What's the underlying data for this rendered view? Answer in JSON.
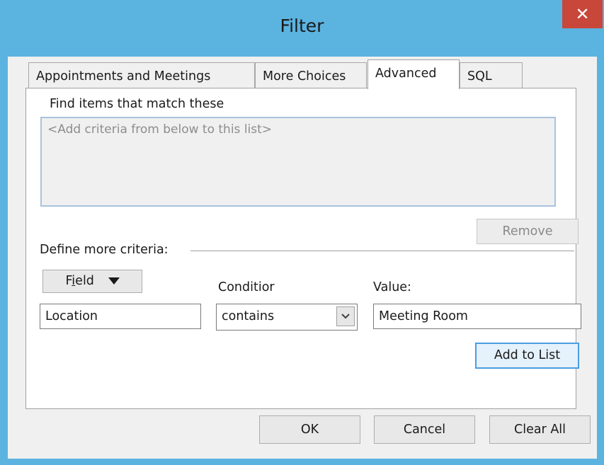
{
  "window": {
    "title": "Filter",
    "close_glyph": "✕"
  },
  "tabs": [
    {
      "label": "Appointments and Meetings"
    },
    {
      "label": "More Choices"
    },
    {
      "label": "Advanced"
    },
    {
      "label": "SQL"
    }
  ],
  "advanced": {
    "find_label": "Find items that match these",
    "criteria_placeholder": "<Add criteria from below to this list>",
    "remove_label": "Remove",
    "define_label": "Define more criteria:",
    "field_button": {
      "pre": "F",
      "underlined": "i",
      "post": "eld"
    },
    "condition_label": "Conditior",
    "value_label": "Value:",
    "field_value": "Location",
    "condition_value": "contains",
    "value_value": "Meeting Room",
    "add_to_list_label": "Add to List"
  },
  "footer": {
    "ok_label": "OK",
    "cancel_label": "Cancel",
    "clear_all_label": "Clear All"
  },
  "colors": {
    "titlebar": "#5bb3e0",
    "close": "#c9463a",
    "dialog_bg": "#f0f0f0",
    "default_button_border": "#4a9de0"
  },
  "icons": {
    "close": "close-icon",
    "dropdown": "chevron-down-icon",
    "field_menu": "triangle-down-icon"
  }
}
